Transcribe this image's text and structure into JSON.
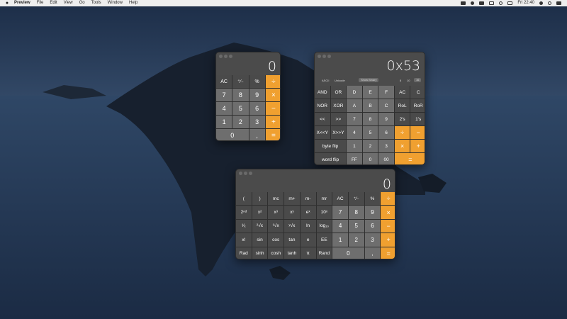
{
  "menubar": {
    "app_name": "Preview",
    "menus": [
      "File",
      "Edit",
      "View",
      "Go",
      "Tools",
      "Window",
      "Help"
    ],
    "clock": "Fri 22:40",
    "status_icons": [
      "dropbox-icon",
      "bluetooth-icon",
      "volume-icon",
      "airplay-icon",
      "wifi-icon",
      "battery-icon"
    ]
  },
  "colors": {
    "operator": "#f0a030",
    "key": "#5f5f5f",
    "number_key": "#6e6e6e",
    "window": "#4b4b4b"
  },
  "basic": {
    "display": "0",
    "keys": [
      {
        "label": "AC",
        "kind": "fn"
      },
      {
        "label": "⁺∕₋",
        "kind": "fn"
      },
      {
        "label": "%",
        "kind": "fn"
      },
      {
        "label": "÷",
        "kind": "op"
      },
      {
        "label": "7",
        "kind": "num"
      },
      {
        "label": "8",
        "kind": "num"
      },
      {
        "label": "9",
        "kind": "num"
      },
      {
        "label": "×",
        "kind": "op"
      },
      {
        "label": "4",
        "kind": "num"
      },
      {
        "label": "5",
        "kind": "num"
      },
      {
        "label": "6",
        "kind": "num"
      },
      {
        "label": "−",
        "kind": "op"
      },
      {
        "label": "1",
        "kind": "num"
      },
      {
        "label": "2",
        "kind": "num"
      },
      {
        "label": "3",
        "kind": "num"
      },
      {
        "label": "+",
        "kind": "op"
      },
      {
        "label": "0",
        "kind": "num",
        "span": 2
      },
      {
        "label": ",",
        "kind": "num"
      },
      {
        "label": "=",
        "kind": "op"
      }
    ]
  },
  "programmer": {
    "display": "0x53",
    "modes": [
      "ASCII",
      "Unicode"
    ],
    "show_binary": "Show Binary",
    "bases": [
      "8",
      "10",
      "16"
    ],
    "keys": [
      {
        "label": "AND",
        "kind": "fn"
      },
      {
        "label": "OR",
        "kind": "fn"
      },
      {
        "label": "D",
        "kind": "num"
      },
      {
        "label": "E",
        "kind": "num"
      },
      {
        "label": "F",
        "kind": "num"
      },
      {
        "label": "AC",
        "kind": "fn"
      },
      {
        "label": "C",
        "kind": "fn"
      },
      {
        "label": "NOR",
        "kind": "fn"
      },
      {
        "label": "XOR",
        "kind": "fn"
      },
      {
        "label": "A",
        "kind": "num"
      },
      {
        "label": "B",
        "kind": "num"
      },
      {
        "label": "C",
        "kind": "num"
      },
      {
        "label": "RoL",
        "kind": "fn"
      },
      {
        "label": "RoR",
        "kind": "fn"
      },
      {
        "label": "<<",
        "kind": "fn"
      },
      {
        "label": ">>",
        "kind": "fn"
      },
      {
        "label": "7",
        "kind": "num"
      },
      {
        "label": "8",
        "kind": "num"
      },
      {
        "label": "9",
        "kind": "num"
      },
      {
        "label": "2's",
        "kind": "fn"
      },
      {
        "label": "1's",
        "kind": "fn"
      },
      {
        "label": "X<<Y",
        "kind": "fn"
      },
      {
        "label": "X>>Y",
        "kind": "fn"
      },
      {
        "label": "4",
        "kind": "num"
      },
      {
        "label": "5",
        "kind": "num"
      },
      {
        "label": "6",
        "kind": "num"
      },
      {
        "label": "÷",
        "kind": "op"
      },
      {
        "label": "−",
        "kind": "op"
      },
      {
        "label": "byte flip",
        "kind": "fn",
        "span": 2
      },
      {
        "label": "1",
        "kind": "num"
      },
      {
        "label": "2",
        "kind": "num"
      },
      {
        "label": "3",
        "kind": "num"
      },
      {
        "label": "×",
        "kind": "op"
      },
      {
        "label": "+",
        "kind": "op"
      },
      {
        "label": "word flip",
        "kind": "fn",
        "span": 2
      },
      {
        "label": "FF",
        "kind": "num"
      },
      {
        "label": "0",
        "kind": "num"
      },
      {
        "label": "00",
        "kind": "num"
      },
      {
        "label": "=",
        "kind": "op",
        "span": 2
      }
    ]
  },
  "scientific": {
    "display": "0",
    "keys": [
      {
        "label": "(",
        "kind": "fn"
      },
      {
        "label": ")",
        "kind": "fn"
      },
      {
        "label": "mc",
        "kind": "fn"
      },
      {
        "label": "m+",
        "kind": "fn"
      },
      {
        "label": "m-",
        "kind": "fn"
      },
      {
        "label": "mr",
        "kind": "fn"
      },
      {
        "label": "AC",
        "kind": "fn"
      },
      {
        "label": "⁺∕₋",
        "kind": "fn"
      },
      {
        "label": "%",
        "kind": "fn"
      },
      {
        "label": "÷",
        "kind": "op"
      },
      {
        "label": "2ⁿᵈ",
        "kind": "fn"
      },
      {
        "label": "x²",
        "kind": "fn"
      },
      {
        "label": "x³",
        "kind": "fn"
      },
      {
        "label": "xʸ",
        "kind": "fn"
      },
      {
        "label": "eˣ",
        "kind": "fn"
      },
      {
        "label": "10ˣ",
        "kind": "fn"
      },
      {
        "label": "7",
        "kind": "num"
      },
      {
        "label": "8",
        "kind": "num"
      },
      {
        "label": "9",
        "kind": "num"
      },
      {
        "label": "×",
        "kind": "op"
      },
      {
        "label": "¹⁄ₓ",
        "kind": "fn"
      },
      {
        "label": "²√x",
        "kind": "fn"
      },
      {
        "label": "³√x",
        "kind": "fn"
      },
      {
        "label": "ʸ√x",
        "kind": "fn"
      },
      {
        "label": "ln",
        "kind": "fn"
      },
      {
        "label": "log₁₀",
        "kind": "fn"
      },
      {
        "label": "4",
        "kind": "num"
      },
      {
        "label": "5",
        "kind": "num"
      },
      {
        "label": "6",
        "kind": "num"
      },
      {
        "label": "−",
        "kind": "op"
      },
      {
        "label": "x!",
        "kind": "fn"
      },
      {
        "label": "sin",
        "kind": "fn"
      },
      {
        "label": "cos",
        "kind": "fn"
      },
      {
        "label": "tan",
        "kind": "fn"
      },
      {
        "label": "e",
        "kind": "fn"
      },
      {
        "label": "EE",
        "kind": "fn"
      },
      {
        "label": "1",
        "kind": "num"
      },
      {
        "label": "2",
        "kind": "num"
      },
      {
        "label": "3",
        "kind": "num"
      },
      {
        "label": "+",
        "kind": "op"
      },
      {
        "label": "Rad",
        "kind": "fn"
      },
      {
        "label": "sinh",
        "kind": "fn"
      },
      {
        "label": "cosh",
        "kind": "fn"
      },
      {
        "label": "tanh",
        "kind": "fn"
      },
      {
        "label": "π",
        "kind": "fn"
      },
      {
        "label": "Rand",
        "kind": "fn"
      },
      {
        "label": "0",
        "kind": "num",
        "span": 2
      },
      {
        "label": ",",
        "kind": "num"
      },
      {
        "label": "=",
        "kind": "op"
      }
    ]
  }
}
